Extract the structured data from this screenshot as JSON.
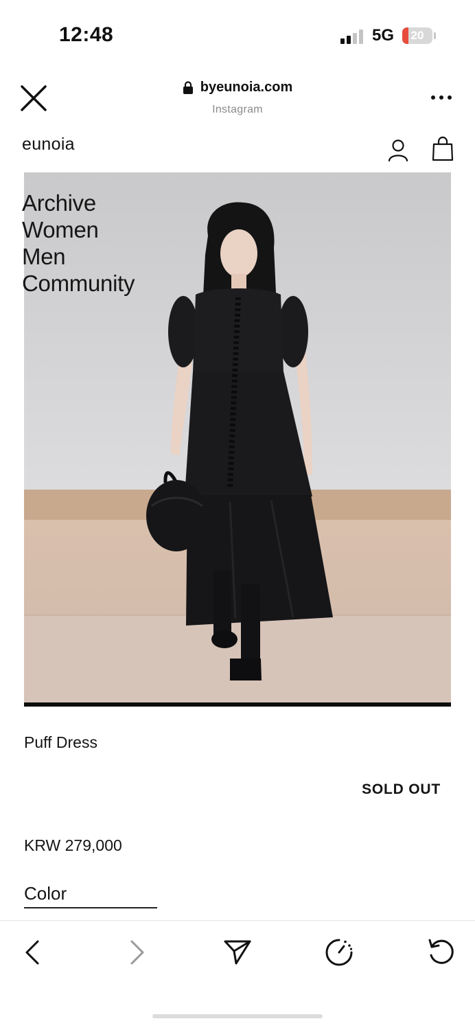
{
  "status_bar": {
    "time": "12:48",
    "network": "5G",
    "battery_level": "20",
    "battery_fraction": 0.2,
    "battery_color": "#e74c3c"
  },
  "browser": {
    "domain": "byeunoia.com",
    "source": "Instagram",
    "icons": [
      "close-icon",
      "lock-icon",
      "more-icon"
    ]
  },
  "site": {
    "brand": "eunoia",
    "icons": [
      "account-icon",
      "shopping-bag-icon"
    ]
  },
  "menu": {
    "items": [
      "Archive",
      "Women",
      "Men",
      "Community"
    ]
  },
  "product": {
    "name": "Puff Dress",
    "status": "SOLD OUT",
    "price": "KRW 279,000",
    "color_label": "Color"
  },
  "toolbar": {
    "icons": [
      "back-icon",
      "forward-icon",
      "share-icon",
      "timer-icon",
      "refresh-icon"
    ]
  }
}
